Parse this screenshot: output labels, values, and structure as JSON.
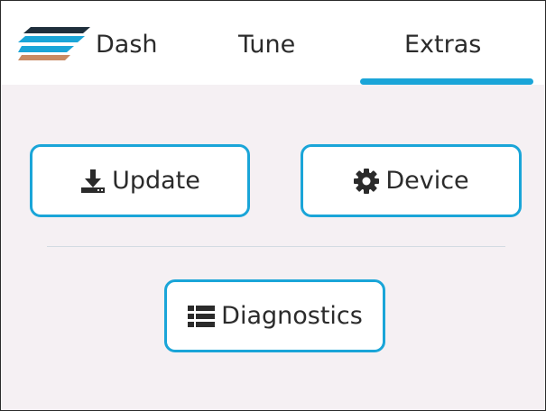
{
  "tabs": {
    "dash": "Dash",
    "tune": "Tune",
    "extras": "Extras",
    "active": "Extras"
  },
  "actions": {
    "update_label": "Update",
    "device_label": "Device",
    "diagnostics_label": "Diagnostics"
  },
  "colors": {
    "accent": "#1aa5d8",
    "content_bg": "#f5f0f3",
    "logo_top": "#1f2f3c",
    "logo_middle": "#1aa5d8",
    "logo_bottom": "#c98a62"
  },
  "icons": {
    "logo": "stripes-logo",
    "update": "download-icon",
    "device": "gear-icon",
    "diagnostics": "list-icon"
  }
}
